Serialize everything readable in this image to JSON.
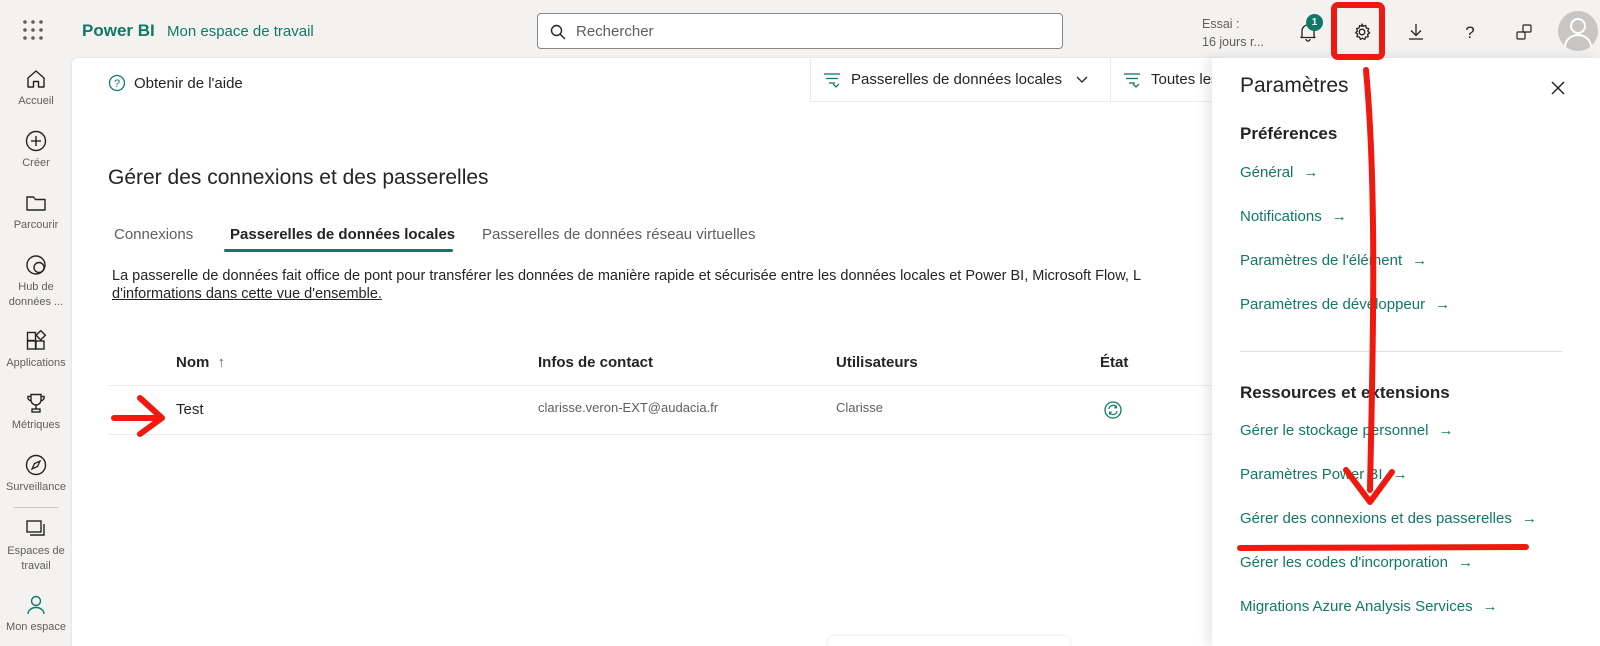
{
  "topbar": {
    "brand": "Power BI",
    "workspace": "Mon espace de travail",
    "search_placeholder": "Rechercher",
    "trial_line1": "Essai :",
    "trial_line2": "16 jours r...",
    "notifications_count": "1",
    "icons": [
      "waffle-icon",
      "search-icon",
      "bell-icon",
      "gear-icon",
      "download-icon",
      "help-icon",
      "share-icon",
      "avatar"
    ]
  },
  "leftnav": {
    "items": [
      {
        "label": "Accueil",
        "icon": "home-icon"
      },
      {
        "label": "Créer",
        "icon": "plus-circle-icon"
      },
      {
        "label": "Parcourir",
        "icon": "folder-icon"
      },
      {
        "label": "Hub de données ...",
        "icon": "data-hub-icon"
      },
      {
        "label": "Applications",
        "icon": "apps-icon"
      },
      {
        "label": "Métriques",
        "icon": "trophy-icon"
      },
      {
        "label": "Surveillance",
        "icon": "compass-icon"
      },
      {
        "label": "Espaces de travail",
        "icon": "workspaces-icon"
      },
      {
        "label": "Mon espace",
        "icon": "person-icon"
      }
    ]
  },
  "main": {
    "help": "Obtenir de l'aide",
    "filter1": "Passerelles de données locales",
    "filter2": "Toutes les",
    "title": "Gérer des connexions et des passerelles",
    "tabs": [
      {
        "label": "Connexions",
        "active": false
      },
      {
        "label": "Passerelles de données locales",
        "active": true
      },
      {
        "label": "Passerelles de données réseau virtuelles",
        "active": false
      }
    ],
    "description": "La passerelle de données fait office de pont pour transférer les données de manière rapide et sécurisée entre les données locales et Power BI, Microsoft Flow, L",
    "description_link": "d'informations dans cette vue d'ensemble.",
    "table": {
      "headers": {
        "name": "Nom",
        "sort_arrow": "↑",
        "contact": "Infos de contact",
        "users": "Utilisateurs",
        "state": "État"
      },
      "rows": [
        {
          "name": "Test",
          "contact": "clarisse.veron-EXT@audacia.fr",
          "users": "Clarisse",
          "state_icon": "sync-status-icon"
        }
      ]
    }
  },
  "panel": {
    "title": "Paramètres",
    "preferences": {
      "heading": "Préférences",
      "links": [
        "Général",
        "Notifications",
        "Paramètres de l'élément",
        "Paramètres de développeur"
      ]
    },
    "resources": {
      "heading": "Ressources et extensions",
      "links": [
        "Gérer le stockage personnel",
        "Paramètres Power BI",
        "Gérer des connexions et des passerelles",
        "Gérer les codes d'incorporation",
        "Migrations Azure Analysis Services"
      ]
    }
  },
  "colors": {
    "accent": "#117865",
    "annotation": "#f0190f",
    "text": "#252423",
    "muted": "#605e5c"
  }
}
